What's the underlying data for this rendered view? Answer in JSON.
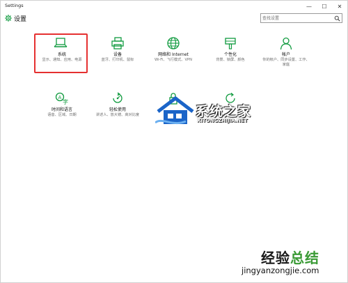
{
  "window": {
    "title": "Settings",
    "minimize_glyph": "—",
    "maximize_glyph": "☐",
    "close_glyph": "✕"
  },
  "header": {
    "title": "设置",
    "icon": "gear-icon"
  },
  "search": {
    "placeholder": "查找设置",
    "value": "查找设置",
    "icon": "search-icon"
  },
  "accent_color": "#0f9a3e",
  "tiles": [
    {
      "icon": "laptop-icon",
      "name": "系统",
      "desc": "显示、通知、应用、电源",
      "selected": true
    },
    {
      "icon": "devices-icon",
      "name": "设备",
      "desc": "蓝牙、打印机、鼠标",
      "selected": false
    },
    {
      "icon": "globe-icon",
      "name": "网络和 Internet",
      "desc": "Wi-Fi、飞行模式、VPN",
      "selected": false
    },
    {
      "icon": "paintbrush-icon",
      "name": "个性化",
      "desc": "背景、锁屏、颜色",
      "selected": false
    },
    {
      "icon": "person-icon",
      "name": "帐户",
      "desc": "你的帐户、同步设置、工作、家庭",
      "selected": false
    },
    {
      "icon": "time-language-icon",
      "name": "时间和语言",
      "desc": "语音、区域、日期",
      "selected": false
    },
    {
      "icon": "ease-of-access-icon",
      "name": "轻松使用",
      "desc": "讲述人、放大镜、高对比度",
      "selected": false
    },
    {
      "icon": "privacy-lock-icon",
      "name": "",
      "desc": "",
      "selected": false
    },
    {
      "icon": "update-security-icon",
      "name": "",
      "desc": "",
      "selected": false
    }
  ],
  "watermarks": {
    "site1_title": "系统之家",
    "site1_url": "XITONGZHIJIA.NET",
    "site2_title_a": "经验",
    "site2_title_b": "总结",
    "site2_url": "jingyanzongjie.com"
  }
}
